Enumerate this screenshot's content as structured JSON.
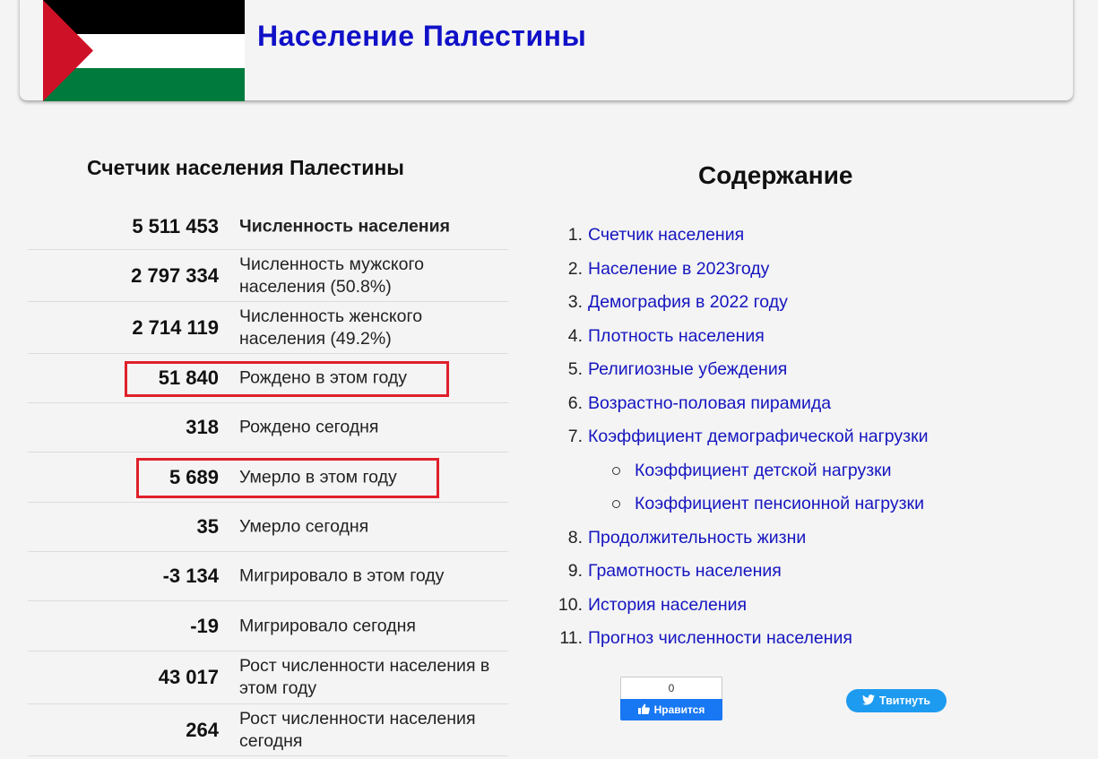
{
  "header": {
    "title": "Население Палестины"
  },
  "counter": {
    "title": "Счетчик населения Палестины",
    "rows": [
      {
        "value": "5 511 453",
        "label": "Численность населения"
      },
      {
        "value": "2 797 334",
        "label": "Численность мужского населения (50.8%)"
      },
      {
        "value": "2 714 119",
        "label": "Численность женского населения (49.2%)"
      },
      {
        "value": "51 840",
        "label": "Рождено в этом году"
      },
      {
        "value": "318",
        "label": "Рождено сегодня"
      },
      {
        "value": "5 689",
        "label": "Умерло в этом году"
      },
      {
        "value": "35",
        "label": "Умерло сегодня"
      },
      {
        "value": "-3 134",
        "label": "Мигрировало в этом году"
      },
      {
        "value": "-19",
        "label": "Мигрировало сегодня"
      },
      {
        "value": "43 017",
        "label": "Рост численности населения в этом году"
      },
      {
        "value": "264",
        "label": "Рост численности населения сегодня"
      }
    ]
  },
  "toc": {
    "title": "Содержание",
    "items": [
      {
        "n": "1.",
        "label": "Счетчик населения"
      },
      {
        "n": "2.",
        "label": "Население в 2023году"
      },
      {
        "n": "3.",
        "label": "Демография в 2022 году"
      },
      {
        "n": "4.",
        "label": "Плотность населения"
      },
      {
        "n": "5.",
        "label": "Религиозные убеждения"
      },
      {
        "n": "6.",
        "label": "Возрастно-половая пирамида"
      },
      {
        "n": "7.",
        "label": "Коэффициент демографической нагрузки"
      },
      {
        "n": "8.",
        "label": "Продолжительность жизни"
      },
      {
        "n": "9.",
        "label": "Грамотность населения"
      },
      {
        "n": "10.",
        "label": "История населения"
      },
      {
        "n": "11.",
        "label": "Прогноз численности населения"
      }
    ],
    "subitems": [
      {
        "label": "Коэффициент детской нагрузки"
      },
      {
        "label": "Коэффициент пенсионной нагрузки"
      }
    ]
  },
  "social": {
    "like_count": "0",
    "like_label": "Нравится",
    "tweet_label": "Твитнуть"
  },
  "colors": {
    "link": "#1515c0",
    "title": "#1010c8",
    "highlight": "#e0202a",
    "flag_black": "#000000",
    "flag_white": "#ffffff",
    "flag_green": "#007a3d",
    "flag_red": "#ce1126"
  }
}
